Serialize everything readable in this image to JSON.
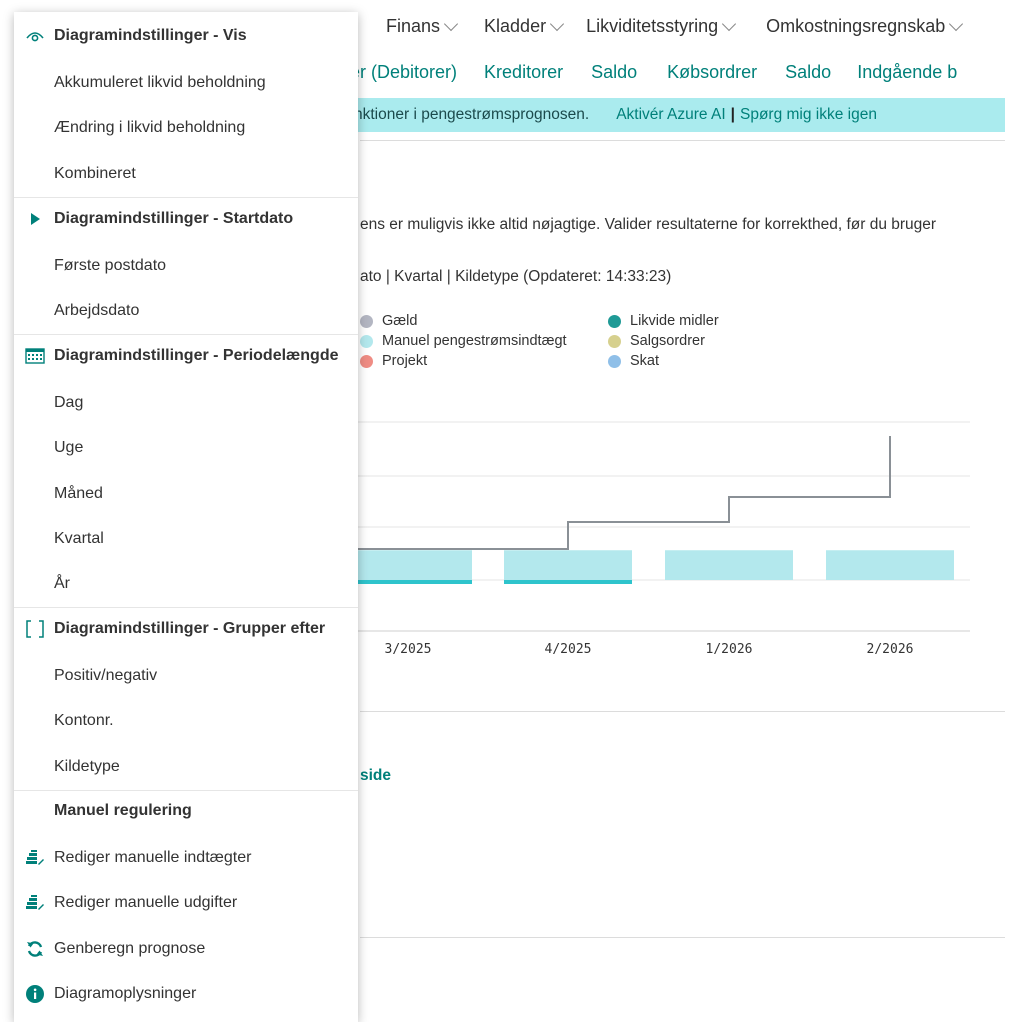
{
  "nav": {
    "items": [
      "Finans",
      "Kladder",
      "Likviditetsstyring",
      "Omkostningsregnskab"
    ]
  },
  "actions": [
    "der (Debitorer)",
    "Kreditorer",
    "Saldo",
    "Købsordrer",
    "Saldo",
    "Indgående b"
  ],
  "banner": {
    "message": "nktioner i pengestrømsprognosen.",
    "enable_link": "Aktivér Azure AI",
    "separator": "|",
    "dismiss_link": "Spørg mig ikke igen"
  },
  "disclaimer": "ens er muligvis ikke altid nøjagtige. Valider resultaterne for korrekthed, før du bruger",
  "chart_subtitle": "ato | Kvartal | Kildetype (Opdateret: 14:33:23)",
  "see_link": "side",
  "colors": {
    "accent": "#00807a",
    "banner_bg": "#aaebee",
    "bar_fill": "#b3e8ed",
    "bar_underline": "#2ec4cc",
    "line": "#8a9096"
  },
  "chart_data": {
    "type": "bar",
    "categories": [
      "3/2025",
      "4/2025",
      "1/2026",
      "2/2026"
    ],
    "legend": [
      {
        "name": "Gæld",
        "color": "#b3b6c2"
      },
      {
        "name": "Manuel pengestrømsindtægt",
        "color": "#b3e8ed"
      },
      {
        "name": "Projekt",
        "color": "#ef8c84"
      },
      {
        "name": "Likvide midler",
        "color": "#1f9a96"
      },
      {
        "name": "Salgsordrer",
        "color": "#d6d08e"
      },
      {
        "name": "Skat",
        "color": "#8fbfe8"
      }
    ],
    "bars": [
      1,
      1,
      1,
      1
    ],
    "underline": [
      true,
      true,
      false,
      false
    ],
    "cumulative_line": [
      1,
      2,
      3,
      4
    ],
    "ylim": [
      0,
      4.3
    ],
    "legend_placement": "top",
    "grid": true
  },
  "menu": {
    "sections": [
      {
        "header": "Diagramindstillinger - Vis",
        "icon": "eye-icon",
        "items": [
          "Akkumuleret likvid beholdning",
          "Ændring i likvid beholdning",
          "Kombineret"
        ]
      },
      {
        "header": "Diagramindstillinger - Startdato",
        "icon": "play-icon",
        "items": [
          "Første postdato",
          "Arbejdsdato"
        ]
      },
      {
        "header": "Diagramindstillinger - Periodelængde",
        "icon": "calendar-icon",
        "items": [
          "Dag",
          "Uge",
          "Måned",
          "Kvartal",
          "År"
        ]
      },
      {
        "header": "Diagramindstillinger - Grupper efter",
        "icon": "bracket-icon",
        "items": [
          "Positiv/negativ",
          "Kontonr.",
          "Kildetype"
        ]
      },
      {
        "header": "Manuel regulering",
        "icon": "",
        "items": []
      }
    ],
    "actions": [
      {
        "label": "Rediger manuelle indtægter",
        "icon": "money-edit-icon"
      },
      {
        "label": "Rediger manuelle udgifter",
        "icon": "money-edit-icon"
      },
      {
        "label": "Genberegn prognose",
        "icon": "refresh-icon"
      },
      {
        "label": "Diagramoplysninger",
        "icon": "info-icon"
      }
    ]
  }
}
